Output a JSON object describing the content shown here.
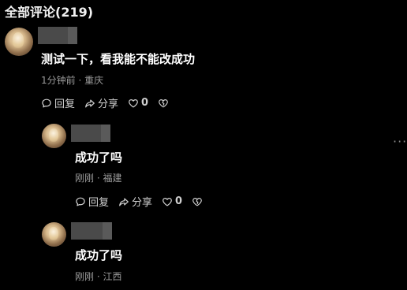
{
  "header": {
    "title": "全部评论(219)"
  },
  "comments": [
    {
      "text": "测试一下，看我能不能改成功",
      "time": "1分钟前",
      "location": "重庆",
      "reply_label": "回复",
      "share_label": "分享",
      "like_count": "0"
    },
    {
      "text": "成功了吗",
      "time": "刚刚",
      "location": "福建",
      "reply_label": "回复",
      "share_label": "分享",
      "like_count": "0"
    },
    {
      "text": "成功了吗",
      "time": "刚刚",
      "location": "江西"
    }
  ],
  "meta_separator": "·",
  "icons": {
    "reply": "speech-bubble-icon",
    "share": "share-arrow-icon",
    "like": "heart-icon",
    "dislike": "broken-heart-icon",
    "more": "more-dots-icon"
  },
  "more_menu": "···",
  "colors": {
    "background": "#000000",
    "text": "#ffffff",
    "meta": "#9b9b9b",
    "blurred_name": "#4a4a4a"
  }
}
